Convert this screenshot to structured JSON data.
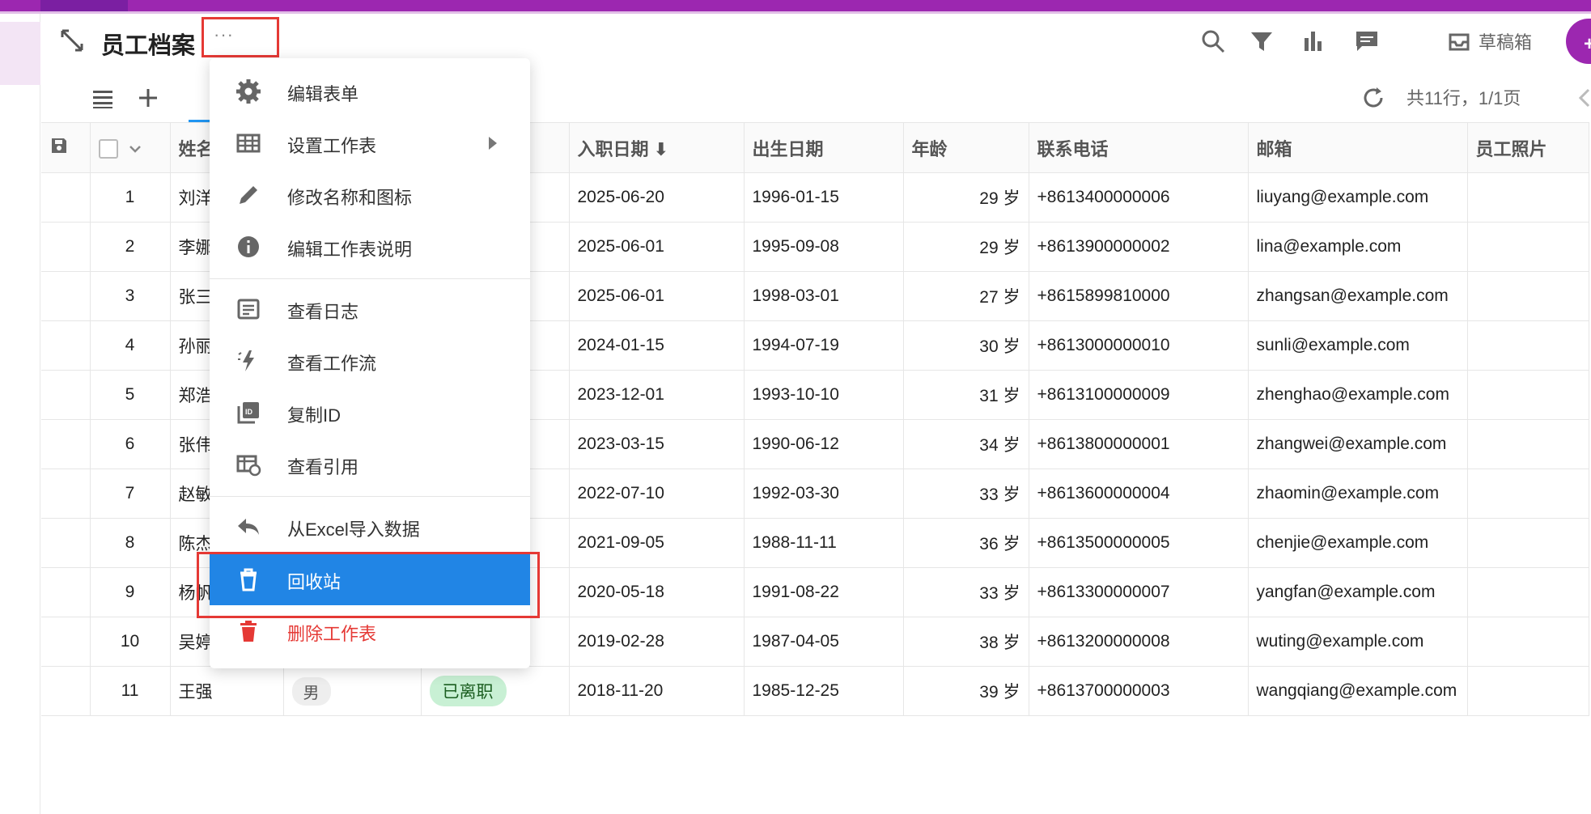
{
  "header": {
    "title": "员工档案",
    "more_label": "···",
    "draft_label": "草稿箱",
    "add_label": "+ 记"
  },
  "toolbar": {
    "page_info": "共11行，1/1页"
  },
  "table": {
    "columns": [
      "姓名",
      "",
      "",
      "入职日期 ⬇",
      "出生日期",
      "年龄",
      "联系电话",
      "邮箱",
      "员工照片"
    ],
    "rows": [
      {
        "n": "1",
        "name": "刘洋",
        "gender": "",
        "status": "",
        "hire": "2025-06-20",
        "birth": "1996-01-15",
        "age": "29 岁",
        "phone": "+8613400000006",
        "email": "liuyang@example.com"
      },
      {
        "n": "2",
        "name": "李娜",
        "gender": "",
        "status": "",
        "hire": "2025-06-01",
        "birth": "1995-09-08",
        "age": "29 岁",
        "phone": "+8613900000002",
        "email": "lina@example.com"
      },
      {
        "n": "3",
        "name": "张三",
        "gender": "",
        "status": "",
        "hire": "2025-06-01",
        "birth": "1998-03-01",
        "age": "27 岁",
        "phone": "+8615899810000",
        "email": "zhangsan@example.com"
      },
      {
        "n": "4",
        "name": "孙丽",
        "gender": "",
        "status": "",
        "hire": "2024-01-15",
        "birth": "1994-07-19",
        "age": "30 岁",
        "phone": "+8613000000010",
        "email": "sunli@example.com"
      },
      {
        "n": "5",
        "name": "郑浩",
        "gender": "",
        "status": "",
        "hire": "2023-12-01",
        "birth": "1993-10-10",
        "age": "31 岁",
        "phone": "+8613100000009",
        "email": "zhenghao@example.com"
      },
      {
        "n": "6",
        "name": "张伟",
        "gender": "",
        "status": "",
        "hire": "2023-03-15",
        "birth": "1990-06-12",
        "age": "34 岁",
        "phone": "+8613800000001",
        "email": "zhangwei@example.com"
      },
      {
        "n": "7",
        "name": "赵敏",
        "gender": "",
        "status": "",
        "hire": "2022-07-10",
        "birth": "1992-03-30",
        "age": "33 岁",
        "phone": "+8613600000004",
        "email": "zhaomin@example.com"
      },
      {
        "n": "8",
        "name": "陈杰",
        "gender": "",
        "status": "",
        "hire": "2021-09-05",
        "birth": "1988-11-11",
        "age": "36 岁",
        "phone": "+8613500000005",
        "email": "chenjie@example.com"
      },
      {
        "n": "9",
        "name": "杨帆",
        "gender": "",
        "status": "",
        "hire": "2020-05-18",
        "birth": "1991-08-22",
        "age": "33 岁",
        "phone": "+8613300000007",
        "email": "yangfan@example.com"
      },
      {
        "n": "10",
        "name": "吴婷",
        "gender": "",
        "status": "",
        "hire": "2019-02-28",
        "birth": "1987-04-05",
        "age": "38 岁",
        "phone": "+8613200000008",
        "email": "wuting@example.com"
      },
      {
        "n": "11",
        "name": "王强",
        "gender": "男",
        "status": "已离职",
        "hire": "2018-11-20",
        "birth": "1985-12-25",
        "age": "39 岁",
        "phone": "+8613700000003",
        "email": "wangqiang@example.com"
      }
    ]
  },
  "menu": {
    "items": [
      {
        "label": "编辑表单",
        "icon": "gear-icon"
      },
      {
        "label": "设置工作表",
        "icon": "table-icon"
      },
      {
        "label": "修改名称和图标",
        "icon": "pencil-icon"
      },
      {
        "label": "编辑工作表说明",
        "icon": "info-icon"
      },
      {
        "label": "查看日志",
        "icon": "log-icon"
      },
      {
        "label": "查看工作流",
        "icon": "workflow-icon"
      },
      {
        "label": "复制ID",
        "icon": "id-icon"
      },
      {
        "label": "查看引用",
        "icon": "reference-icon"
      },
      {
        "label": "从Excel导入数据",
        "icon": "import-icon"
      },
      {
        "label": "回收站",
        "icon": "trash-icon"
      },
      {
        "label": "删除工作表",
        "icon": "delete-icon"
      }
    ]
  },
  "colors": {
    "brand": "#9c27b0",
    "active": "#2185e5",
    "danger": "#e53935",
    "link": "#1e88e5"
  }
}
